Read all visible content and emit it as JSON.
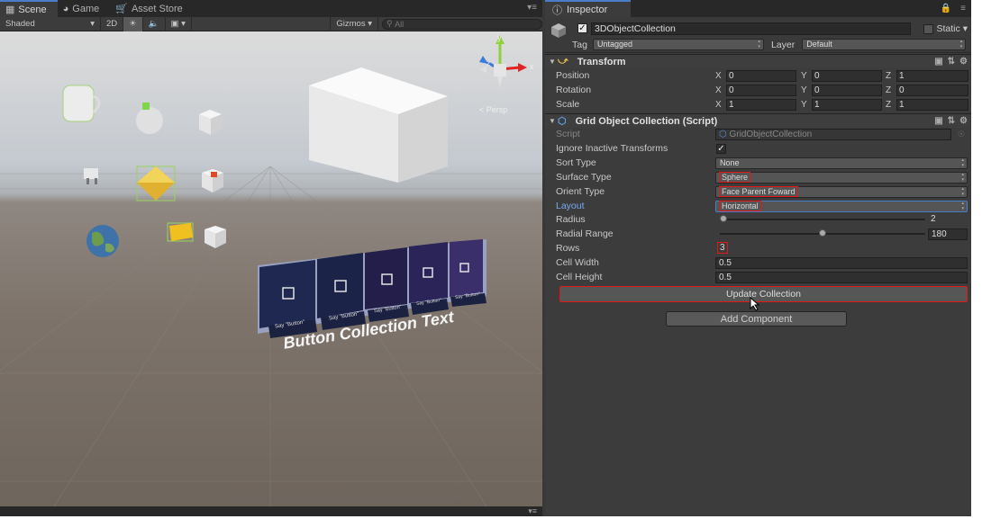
{
  "scene": {
    "tabs": [
      {
        "label": "Scene",
        "icon": "grid-icon"
      },
      {
        "label": "Game",
        "icon": "pacman-icon"
      },
      {
        "label": "Asset Store",
        "icon": "store-icon"
      }
    ],
    "toolbar": {
      "shading": "Shaded",
      "mode_2d": "2D",
      "gizmos": "Gizmos",
      "search_placeholder": "All"
    },
    "persp_label": "< Persp",
    "gizmo_axes": {
      "x": "x",
      "y": "y",
      "z": "z"
    },
    "button_labels": [
      "Say \"Button\"",
      "Say \"Button\"",
      "Say \"Button\"",
      "Say \"Button\"",
      "Say \"Button\""
    ],
    "collection_text": "Button Collection Text"
  },
  "inspector": {
    "tab_label": "Inspector",
    "object": {
      "active": true,
      "name": "3DObjectCollection",
      "static_label": "Static",
      "tag_label": "Tag",
      "tag_value": "Untagged",
      "layer_label": "Layer",
      "layer_value": "Default"
    },
    "transform": {
      "title": "Transform",
      "rows": [
        {
          "label": "Position",
          "x": "0",
          "y": "0",
          "z": "1"
        },
        {
          "label": "Rotation",
          "x": "0",
          "y": "0",
          "z": "0"
        },
        {
          "label": "Scale",
          "x": "1",
          "y": "1",
          "z": "1"
        }
      ],
      "axis_x": "X",
      "axis_y": "Y",
      "axis_z": "Z"
    },
    "grid_collection": {
      "title": "Grid Object Collection (Script)",
      "script_label": "Script",
      "script_value": "GridObjectCollection",
      "ignore_inactive_label": "Ignore Inactive Transforms",
      "ignore_inactive_checked": true,
      "sort_type_label": "Sort Type",
      "sort_type_value": "None",
      "surface_type_label": "Surface Type",
      "surface_type_value": "Sphere",
      "orient_type_label": "Orient Type",
      "orient_type_value": "Face Parent Foward",
      "layout_label": "Layout",
      "layout_value": "Horizontal",
      "radius_label": "Radius",
      "radius_value": "2",
      "radius_fraction": 0.0,
      "radial_range_label": "Radial Range",
      "radial_range_value": "180",
      "radial_range_fraction": 0.5,
      "rows_label": "Rows",
      "rows_value": "3",
      "cell_width_label": "Cell Width",
      "cell_width_value": "0.5",
      "cell_height_label": "Cell Height",
      "cell_height_value": "0.5",
      "update_button": "Update Collection"
    },
    "add_component": "Add Component"
  }
}
